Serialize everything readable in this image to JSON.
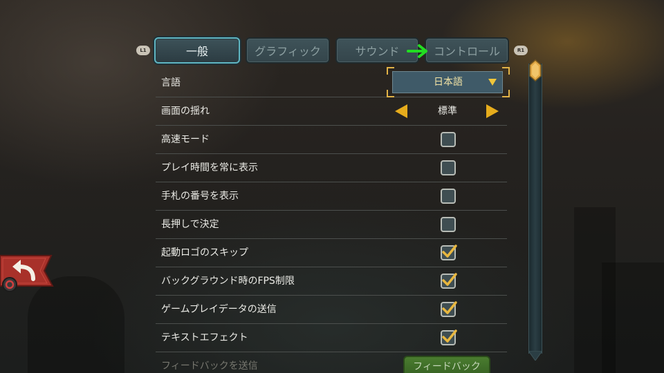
{
  "colors": {
    "accent_tab_border": "#5fb6c3",
    "check_gold": "#e8b73f",
    "arrow_gold": "#e6ac1c",
    "nav_green_arrow": "#22dd22",
    "back_button_red": "#a8312a"
  },
  "shoulder_buttons": {
    "left": "L1",
    "right": "R1"
  },
  "tabs": [
    {
      "label": "一般",
      "active": true
    },
    {
      "label": "グラフィック",
      "active": false
    },
    {
      "label": "サウンド",
      "active": false
    },
    {
      "label": "コントロール",
      "active": false
    }
  ],
  "settings": {
    "language": {
      "label": "言語",
      "value": "日本語",
      "icon": "caret-down-icon"
    },
    "screen_shake": {
      "label": "画面の揺れ",
      "value": "標準",
      "prev_icon": "arrow-left-icon",
      "next_icon": "arrow-right-icon"
    },
    "checkboxes": [
      {
        "label": "高速モード",
        "checked": false
      },
      {
        "label": "プレイ時間を常に表示",
        "checked": false
      },
      {
        "label": "手札の番号を表示",
        "checked": false
      },
      {
        "label": "長押しで決定",
        "checked": false
      },
      {
        "label": "起動ロゴのスキップ",
        "checked": true
      },
      {
        "label": "バックグラウンド時のFPS制限",
        "checked": true
      },
      {
        "label": "ゲームプレイデータの送信",
        "checked": true
      },
      {
        "label": "テキストエフェクト",
        "checked": true
      }
    ],
    "feedback": {
      "label": "フィードバックを送信",
      "button_label": "フィードバック"
    }
  },
  "scrollbar": {
    "position": 0
  },
  "back_button": {
    "icon": "back-arrow-icon"
  }
}
